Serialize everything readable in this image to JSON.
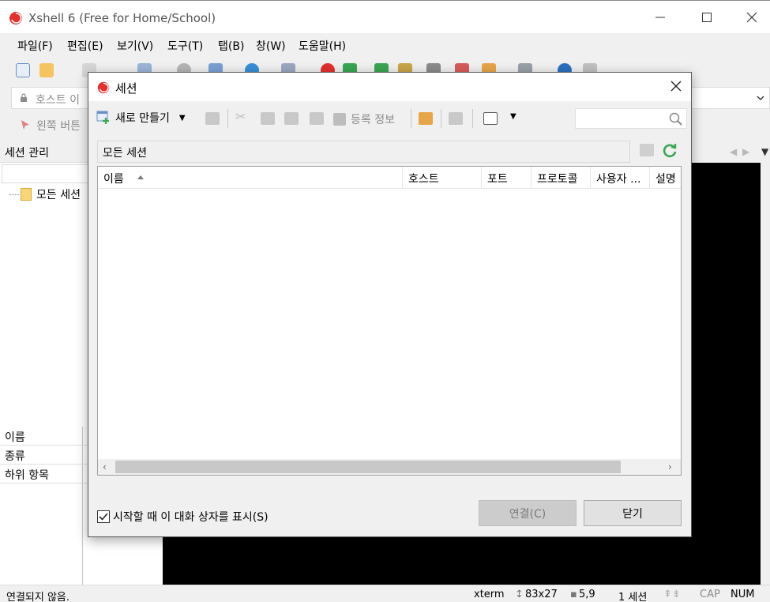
{
  "window": {
    "title": "Xshell 6 (Free for Home/School)"
  },
  "menu": {
    "items": [
      "파일(F)",
      "편집(E)",
      "보기(V)",
      "도구(T)",
      "탭(B)",
      "창(W)",
      "도움말(H)"
    ]
  },
  "address": {
    "placeholder": "호스트 이",
    "link_text": "왼쪽 버튼"
  },
  "session_panel": {
    "header": "세션 관리",
    "tree_root": "모든 세션"
  },
  "properties": {
    "rows": [
      "이름",
      "종류",
      "하위 항목"
    ]
  },
  "status": {
    "connection": "연결되지 않음.",
    "term": "xterm",
    "size": "83x27",
    "cursor": "5,9",
    "sessions": "1 세션",
    "cap": "CAP",
    "num": "NUM"
  },
  "dialog": {
    "title": "세션",
    "new_label": "새로 만들기",
    "properties_label": "등록 정보",
    "path": "모든 세션",
    "columns": [
      "이름",
      "호스트",
      "포트",
      "프로토콜",
      "사용자 ...",
      "설명"
    ],
    "show_on_startup_label": "시작할 때 이 대화 상자를 표시(S)",
    "show_on_startup_checked": true,
    "connect_label": "연결(C)",
    "close_label": "닫기"
  },
  "colors": {
    "brand_red": "#e0312f",
    "accent_green": "#3aa655",
    "terminal_bg": "#000000"
  }
}
